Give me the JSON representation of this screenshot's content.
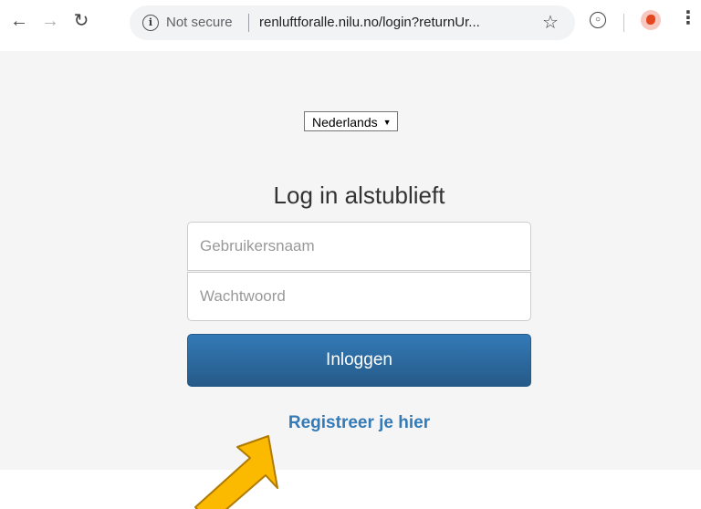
{
  "browser": {
    "security_label": "Not secure",
    "url": "renluftforalle.nilu.no/login?returnUr..."
  },
  "page": {
    "language": {
      "selected": "Nederlands"
    },
    "title": "Log in alstublieft",
    "username_placeholder": "Gebruikersnaam",
    "password_placeholder": "Wachtwoord",
    "login_button": "Inloggen",
    "register_link": "Registreer je hier"
  },
  "colors": {
    "primary_button": "#2d6ca2",
    "link": "#337ab7",
    "annotation_arrow": "#fbb900"
  },
  "icons": [
    "back-icon",
    "forward-icon",
    "reload-icon",
    "info-icon",
    "star-icon",
    "extension-icon",
    "avatar",
    "menu-icon",
    "annotation-arrow"
  ]
}
